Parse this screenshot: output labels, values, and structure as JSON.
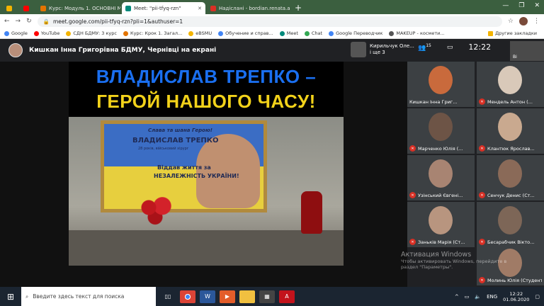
{
  "browser": {
    "tabs": [
      {
        "label": "",
        "color": "#f4b400"
      },
      {
        "label": "",
        "color": "#ff0000"
      },
      {
        "label": "Курс: Модуль 1. ОСНОВНІ МЕТ",
        "color": "#e37400"
      },
      {
        "label": "Meet: \"pii-tfyq-rzn\"",
        "color": "#00897b",
        "active": true
      },
      {
        "label": "Надіслані - bordian.renata.ana",
        "color": "#d93025"
      }
    ],
    "new_tab": "+",
    "url": "meet.google.com/pii-tfyq-rzn?pli=1&authuser=1",
    "bookmarks": [
      {
        "label": "Google",
        "color": "#4285f4"
      },
      {
        "label": "YouTube",
        "color": "#ff0000"
      },
      {
        "label": "СДН БДМУ: 3 курс",
        "color": "#f4b400"
      },
      {
        "label": "Курс: Крок 1. Загал...",
        "color": "#e37400"
      },
      {
        "label": "eBSMU",
        "color": "#f4b400"
      },
      {
        "label": "Обучение и справ...",
        "color": "#4285f4"
      },
      {
        "label": "Meet",
        "color": "#00897b"
      },
      {
        "label": "Chat",
        "color": "#34a853"
      },
      {
        "label": "Google Переводчик",
        "color": "#4285f4"
      },
      {
        "label": "MAKEUP - космети...",
        "color": "#555555"
      },
      {
        "label": "Другие закладки",
        "color": "#f4b400"
      }
    ]
  },
  "meet": {
    "presenter_title": "Кишкан Інна Григорівна БДМУ, Чернівці на екрані",
    "pinned_name": "Кирильчук Оле...",
    "pinned_sub": "і ще 3",
    "participants_count": "15",
    "clock": "12:22",
    "selfview_label": "Ві"
  },
  "slide": {
    "title_line1": "ВЛАДИСЛАВ ТРЕПКО –",
    "title_line2": "ГЕРОЙ НАШОГО ЧАСУ!",
    "frame_header": "Слава та шана Герою!",
    "frame_name": "ВЛАДИСЛАВ ТРЕПКО",
    "frame_sub": "28 років, військовий хірург",
    "frame_quote1": "Віддав життя за",
    "frame_quote2": "НЕЗАЛЕЖНІСТЬ УКРАЇНИ!"
  },
  "participants": [
    {
      "name": "Кишкан Інна Григ...",
      "muted": false
    },
    {
      "name": "Мендель Антон (...",
      "muted": true
    },
    {
      "name": "Марченко Юлія (...",
      "muted": true
    },
    {
      "name": "Клантюк Ярослав...",
      "muted": true
    },
    {
      "name": "Узінський Євгені...",
      "muted": true
    },
    {
      "name": "Сенчук Денис (Ст...",
      "muted": true
    },
    {
      "name": "Заньків Марія (Ст...",
      "muted": true
    },
    {
      "name": "Бесарабчик Вікто...",
      "muted": true
    },
    {
      "name": "Молинь Юлія (Студент БД...",
      "muted": true
    }
  ],
  "watermark": {
    "title": "Активация Windows",
    "line1": "Чтобы активировать Windows, перейдите в",
    "line2": "раздел \"Параметры\"."
  },
  "taskbar": {
    "search_placeholder": "Введите здесь текст для поиска",
    "lang": "ENG",
    "time": "12:22",
    "date": "01.06.2020"
  }
}
